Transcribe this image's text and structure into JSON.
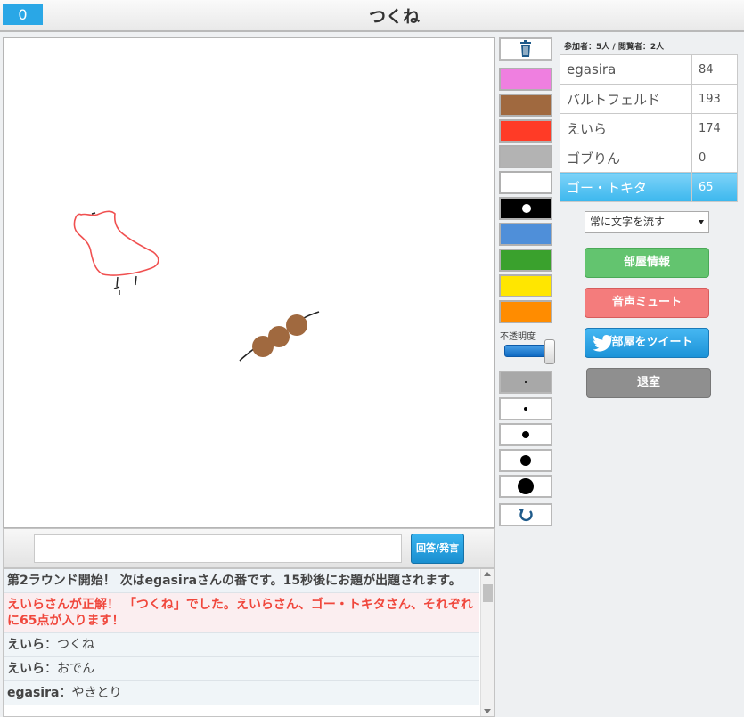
{
  "header": {
    "timer": "0",
    "title": "つくね"
  },
  "answer": {
    "placeholder": "",
    "button_label": "回答/発言"
  },
  "chat": {
    "lines": [
      {
        "type": "sys",
        "text": "第2ラウンド開始！ 次はegasiraさんの番です。15秒後にお題が出題されます。"
      },
      {
        "type": "correct",
        "text": "えいらさんが正解！ 「つくね」でした。えいらさん、ゴー・トキタさん、それぞれに65点が入ります！"
      },
      {
        "type": "msg",
        "name": "えいら",
        "sep": "：",
        "text": "つくね"
      },
      {
        "type": "msg",
        "name": "えいら",
        "sep": "：",
        "text": "おでん"
      },
      {
        "type": "msg",
        "name": "egasira",
        "sep": "：",
        "text": "やきとり"
      }
    ]
  },
  "tools": {
    "trash_icon": "trash-icon",
    "colors": [
      "#ef7fe0",
      "#a0693f",
      "#ff3b26",
      "#b3b3b3",
      "#ffffff",
      "#000000",
      "#4f8fd9",
      "#3aa12d",
      "#ffe600",
      "#ff8c00"
    ],
    "selected_color": "#000000",
    "opacity_label": "不透明度",
    "opacity_value": 1.0,
    "brush_sizes": [
      "size-1",
      "size-2",
      "size-3",
      "size-4",
      "size-5"
    ],
    "selected_size": "size-1",
    "undo_icon": "undo-icon"
  },
  "room": {
    "counts": "参加者：5人 / 閲覧者：2人",
    "players": [
      {
        "name": "egasira",
        "score": "84"
      },
      {
        "name": "バルトフェルド",
        "score": "193"
      },
      {
        "name": "えいら",
        "score": "174"
      },
      {
        "name": "ゴブりん",
        "score": "0"
      },
      {
        "name": "ゴー・トキタ",
        "score": "65",
        "active": true
      }
    ],
    "display_select": "常に文字を流す",
    "buttons": {
      "room_info": "部屋情報",
      "mute": "音声ミュート",
      "tweet": "部屋をツイート",
      "leave": "退室"
    }
  }
}
